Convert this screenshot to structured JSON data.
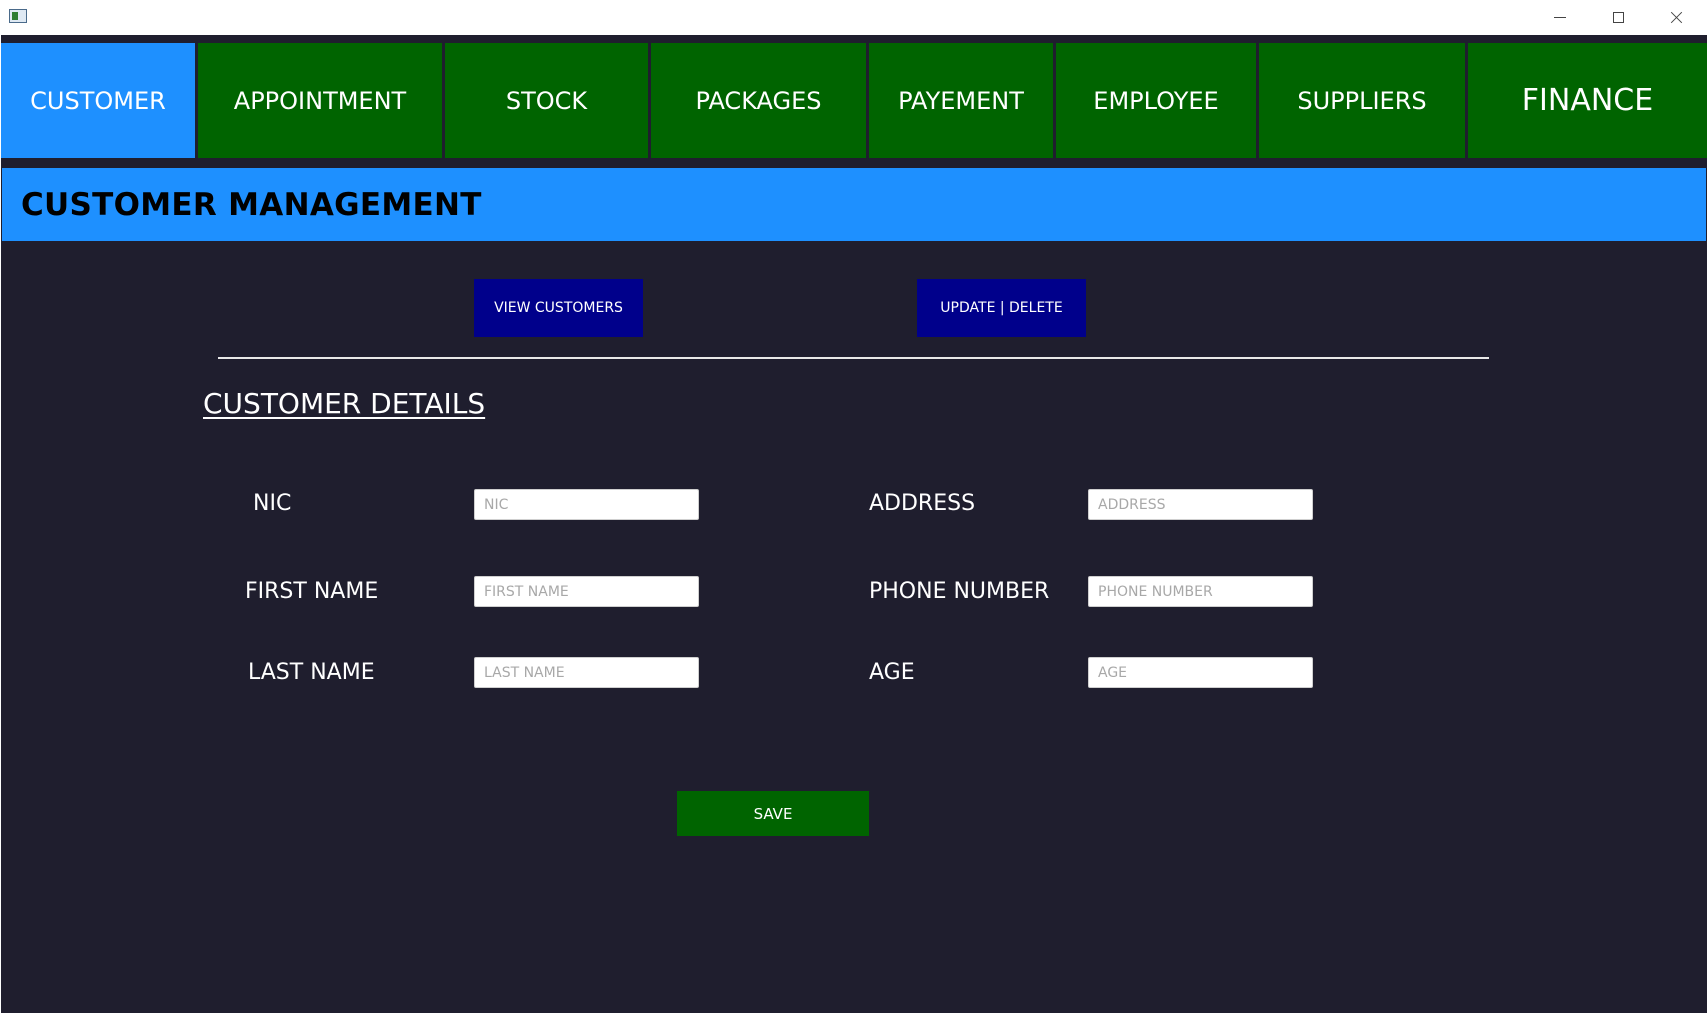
{
  "window": {
    "app_icon": "app-window-icon",
    "controls": {
      "minimize_icon": "minimize-icon",
      "maximize_icon": "maximize-icon",
      "close_icon": "close-icon"
    }
  },
  "nav": {
    "tabs": [
      {
        "label": "CUSTOMER",
        "active": true
      },
      {
        "label": "APPOINTMENT",
        "active": false
      },
      {
        "label": "STOCK",
        "active": false
      },
      {
        "label": "PACKAGES",
        "active": false
      },
      {
        "label": "PAYEMENT",
        "active": false
      },
      {
        "label": "EMPLOYEE",
        "active": false
      },
      {
        "label": "SUPPLIERS",
        "active": false
      },
      {
        "label": "FINANCE",
        "active": false
      }
    ]
  },
  "header": {
    "title": "CUSTOMER MANAGEMENT"
  },
  "actions": {
    "view_customers": "VIEW CUSTOMERS",
    "update_delete": "UPDATE | DELETE"
  },
  "section": {
    "title": "CUSTOMER DETAILS"
  },
  "form": {
    "nic": {
      "label": "NIC",
      "placeholder": "NIC",
      "value": ""
    },
    "first_name": {
      "label": "FIRST NAME",
      "placeholder": "FIRST NAME",
      "value": ""
    },
    "last_name": {
      "label": "LAST NAME",
      "placeholder": "LAST NAME",
      "value": ""
    },
    "address": {
      "label": "ADDRESS",
      "placeholder": "ADDRESS",
      "value": ""
    },
    "phone_number": {
      "label": "PHONE NUMBER",
      "placeholder": "PHONE NUMBER",
      "value": ""
    },
    "age": {
      "label": "AGE",
      "placeholder": "AGE",
      "value": ""
    },
    "save_label": "SAVE"
  },
  "colors": {
    "background": "#1f1e2e",
    "tab_active": "#1e90ff",
    "tab_inactive": "#006400",
    "header_band": "#1e90ff",
    "action_button": "#00008b",
    "save_button": "#006400"
  }
}
